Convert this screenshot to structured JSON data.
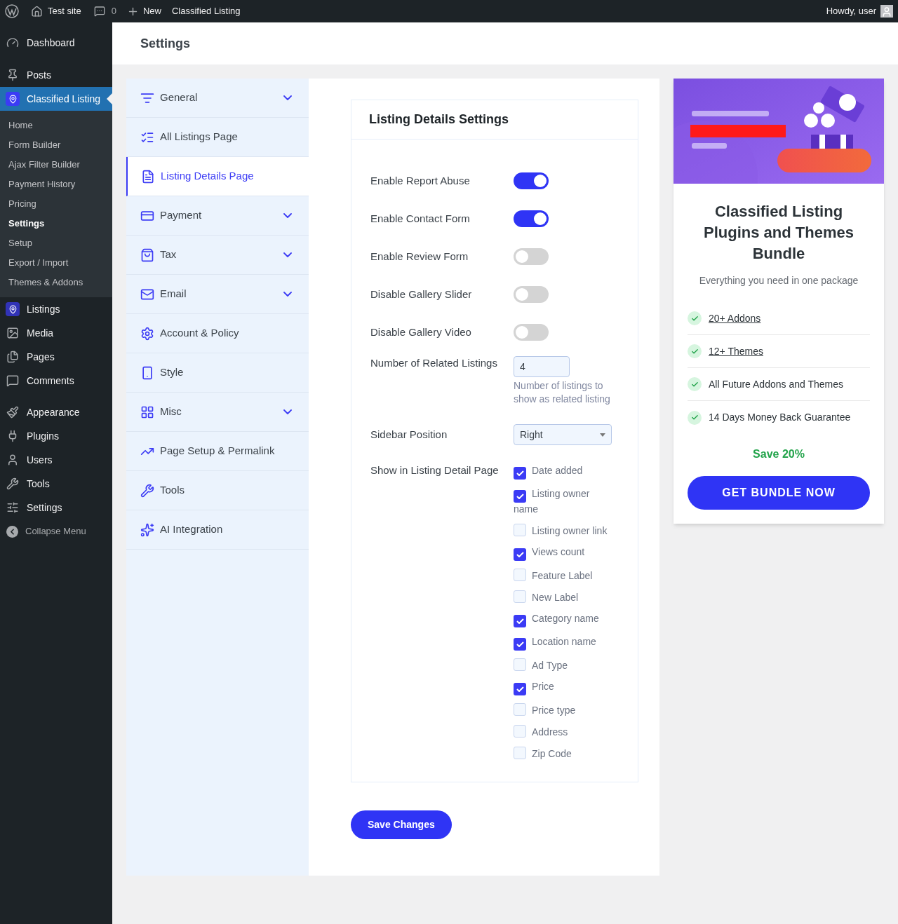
{
  "admin_bar": {
    "site": "Test site",
    "comments": "0",
    "new": "New",
    "plugin": "Classified Listing",
    "greeting": "Howdy, user"
  },
  "sidebar": {
    "items": [
      {
        "label": "Dashboard",
        "selected": false
      },
      {
        "label": "Posts",
        "selected": false
      },
      {
        "label": "Classified Listing",
        "selected": true,
        "children": [
          {
            "label": "Home",
            "selected": false
          },
          {
            "label": "Form Builder",
            "selected": false
          },
          {
            "label": "Ajax Filter Builder",
            "selected": false
          },
          {
            "label": "Payment History",
            "selected": false
          },
          {
            "label": "Pricing",
            "selected": false
          },
          {
            "label": "Settings",
            "selected": true
          },
          {
            "label": "Setup",
            "selected": false
          },
          {
            "label": "Export / Import",
            "selected": false
          },
          {
            "label": "Themes & Addons",
            "selected": false
          }
        ]
      },
      {
        "label": "Listings",
        "selected": false
      },
      {
        "label": "Media",
        "selected": false
      },
      {
        "label": "Pages",
        "selected": false
      },
      {
        "label": "Comments",
        "selected": false
      },
      {
        "label": "Appearance",
        "selected": false
      },
      {
        "label": "Plugins",
        "selected": false
      },
      {
        "label": "Users",
        "selected": false
      },
      {
        "label": "Tools",
        "selected": false
      },
      {
        "label": "Settings",
        "selected": false
      }
    ],
    "collapse": "Collapse Menu"
  },
  "page_title": "Settings",
  "settings_nav": [
    {
      "label": "General",
      "expandable": true,
      "selected": false
    },
    {
      "label": "All Listings Page",
      "expandable": false,
      "selected": false
    },
    {
      "label": "Listing Details Page",
      "expandable": false,
      "selected": true
    },
    {
      "label": "Payment",
      "expandable": true,
      "selected": false
    },
    {
      "label": "Tax",
      "expandable": true,
      "selected": false
    },
    {
      "label": "Email",
      "expandable": true,
      "selected": false
    },
    {
      "label": "Account & Policy",
      "expandable": false,
      "selected": false
    },
    {
      "label": "Style",
      "expandable": false,
      "selected": false
    },
    {
      "label": "Misc",
      "expandable": true,
      "selected": false
    },
    {
      "label": "Page Setup & Permalink",
      "expandable": false,
      "selected": false
    },
    {
      "label": "Tools",
      "expandable": false,
      "selected": false
    },
    {
      "label": "AI Integration",
      "expandable": false,
      "selected": false
    }
  ],
  "panel": {
    "title": "Listing Details Settings",
    "fields": [
      {
        "kind": "toggle",
        "label": "Enable Report Abuse",
        "on": true
      },
      {
        "kind": "toggle",
        "label": "Enable Contact Form",
        "on": true
      },
      {
        "kind": "toggle",
        "label": "Enable Review Form",
        "on": false
      },
      {
        "kind": "toggle",
        "label": "Disable Gallery Slider",
        "on": false
      },
      {
        "kind": "toggle",
        "label": "Disable Gallery Video",
        "on": false
      },
      {
        "kind": "number",
        "label": "Number of Related Listings",
        "value": "4",
        "help": "Number of listings to show as related listing"
      },
      {
        "kind": "select",
        "label": "Sidebar Position",
        "value": "Right"
      },
      {
        "kind": "checklist",
        "label": "Show in Listing Detail Page",
        "options": [
          {
            "label": "Date added",
            "checked": true
          },
          {
            "label": "Listing owner name",
            "checked": true
          },
          {
            "label": "Listing owner link",
            "checked": false
          },
          {
            "label": "Views count",
            "checked": true
          },
          {
            "label": "Feature Label",
            "checked": false
          },
          {
            "label": "New Label",
            "checked": false
          },
          {
            "label": "Category name",
            "checked": true
          },
          {
            "label": "Location name",
            "checked": true
          },
          {
            "label": "Ad Type",
            "checked": false
          },
          {
            "label": "Price",
            "checked": true
          },
          {
            "label": "Price type",
            "checked": false
          },
          {
            "label": "Address",
            "checked": false
          },
          {
            "label": "Zip Code",
            "checked": false
          }
        ]
      }
    ]
  },
  "save_button": "Save Changes",
  "promo": {
    "title": "Classified Listing Plugins and Themes Bundle",
    "subtitle": "Everything you need in one package",
    "features": [
      {
        "label": "20+ Addons",
        "link": true
      },
      {
        "label": "12+ Themes",
        "link": true
      },
      {
        "label": "All Future Addons and Themes",
        "link": false
      },
      {
        "label": "14 Days Money Back Guarantee",
        "link": false
      }
    ],
    "save": "Save 20%",
    "button": "GET BUNDLE NOW"
  }
}
